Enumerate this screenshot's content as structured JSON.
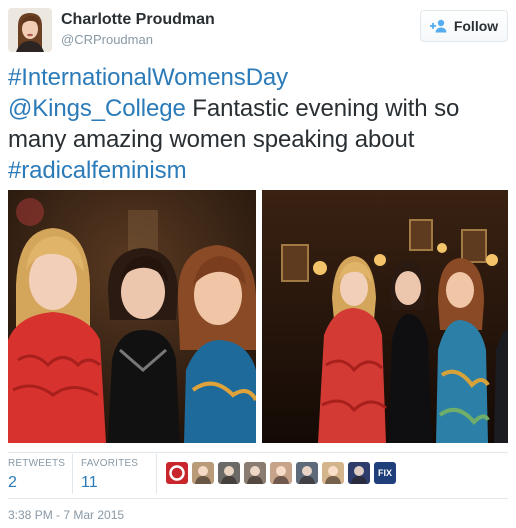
{
  "user": {
    "name": "Charlotte Proudman",
    "handle": "@CRProudman"
  },
  "follow": {
    "label": "Follow"
  },
  "tweet": {
    "hashtag_iwd": "#InternationalWomensDay",
    "mention": "@Kings_College",
    "text": " Fantastic evening with so many amazing women speaking about ",
    "hashtag_rf": "#radicalfeminism"
  },
  "stats": {
    "retweets_label": "RETWEETS",
    "retweets_count": "2",
    "favorites_label": "FAVORITES",
    "favorites_count": "11"
  },
  "favoriters": [
    {
      "name": "favoriter-1",
      "color": "#c9252c",
      "icon": "circle-logo"
    },
    {
      "name": "favoriter-2",
      "color": "#b99b7a"
    },
    {
      "name": "favoriter-3",
      "color": "#6c6a66"
    },
    {
      "name": "favoriter-4",
      "color": "#8a7c70"
    },
    {
      "name": "favoriter-5",
      "color": "#c7a38a"
    },
    {
      "name": "favoriter-6",
      "color": "#5d6a7a"
    },
    {
      "name": "favoriter-7",
      "color": "#d4b48b"
    },
    {
      "name": "favoriter-8",
      "color": "#2d3c6b"
    },
    {
      "name": "favoriter-9",
      "color": "#1f3f7a",
      "label": "FIX"
    }
  ],
  "timestamp": "3:38 PM - 7 Mar 2015",
  "colors": {
    "link": "#2b7bb9",
    "text": "#292f33",
    "muted": "#8899a6",
    "border": "#e1e8ed"
  }
}
